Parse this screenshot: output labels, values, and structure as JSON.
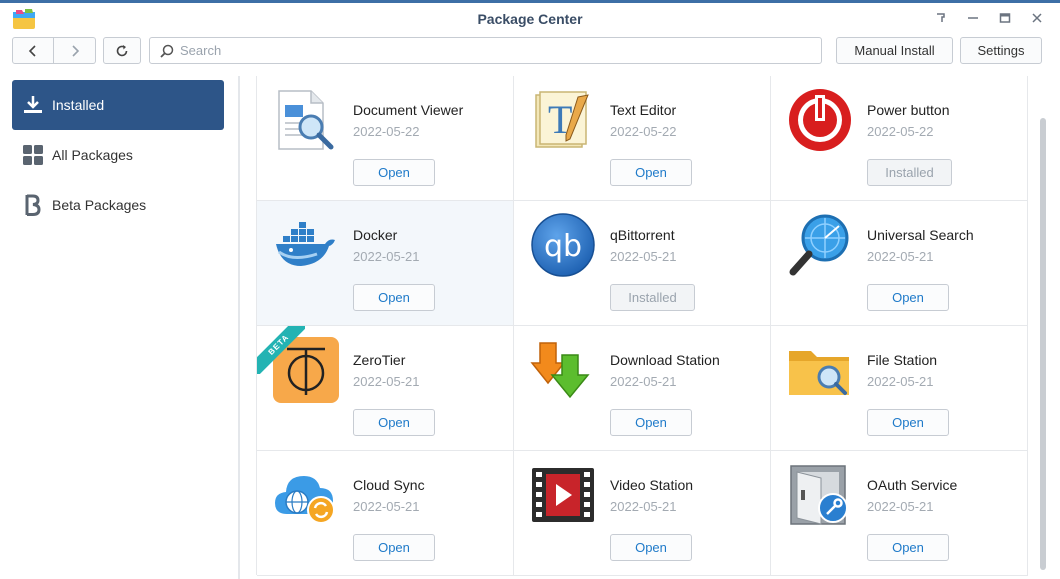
{
  "window": {
    "title": "Package Center",
    "controls": [
      "pin-icon",
      "minimize-icon",
      "maximize-icon",
      "close-icon"
    ]
  },
  "toolbar": {
    "search_placeholder": "Search",
    "manual_install_label": "Manual Install",
    "settings_label": "Settings"
  },
  "sidebar": {
    "items": [
      {
        "label": "Installed",
        "icon": "download-icon",
        "active": true
      },
      {
        "label": "All Packages",
        "icon": "grid-icon",
        "active": false
      },
      {
        "label": "Beta Packages",
        "icon": "beta-icon",
        "active": false
      }
    ]
  },
  "packages": [
    {
      "name": "Document Viewer",
      "date": "2022-05-22",
      "button": "Open",
      "icon": "document-viewer-icon"
    },
    {
      "name": "Text Editor",
      "date": "2022-05-22",
      "button": "Open",
      "icon": "text-editor-icon"
    },
    {
      "name": "Power button",
      "date": "2022-05-22",
      "button": "Installed",
      "icon": "power-button-icon"
    },
    {
      "name": "Docker",
      "date": "2022-05-21",
      "button": "Open",
      "icon": "docker-icon"
    },
    {
      "name": "qBittorrent",
      "date": "2022-05-21",
      "button": "Installed",
      "icon": "qbittorrent-icon",
      "icon_text": "qb"
    },
    {
      "name": "Universal Search",
      "date": "2022-05-21",
      "button": "Open",
      "icon": "universal-search-icon"
    },
    {
      "name": "ZeroTier",
      "date": "2022-05-21",
      "button": "Open",
      "icon": "zerotier-icon",
      "badge": "BETA"
    },
    {
      "name": "Download Station",
      "date": "2022-05-21",
      "button": "Open",
      "icon": "download-station-icon"
    },
    {
      "name": "File Station",
      "date": "2022-05-21",
      "button": "Open",
      "icon": "file-station-icon"
    },
    {
      "name": "Cloud Sync",
      "date": "2022-05-21",
      "button": "Open",
      "icon": "cloud-sync-icon"
    },
    {
      "name": "Video Station",
      "date": "2022-05-21",
      "button": "Open",
      "icon": "video-station-icon"
    },
    {
      "name": "OAuth Service",
      "date": "2022-05-21",
      "button": "Open",
      "icon": "oauth-service-icon"
    }
  ],
  "colors": {
    "accent": "#2d5588",
    "link": "#1f7ac9",
    "date": "#a3aab2"
  }
}
